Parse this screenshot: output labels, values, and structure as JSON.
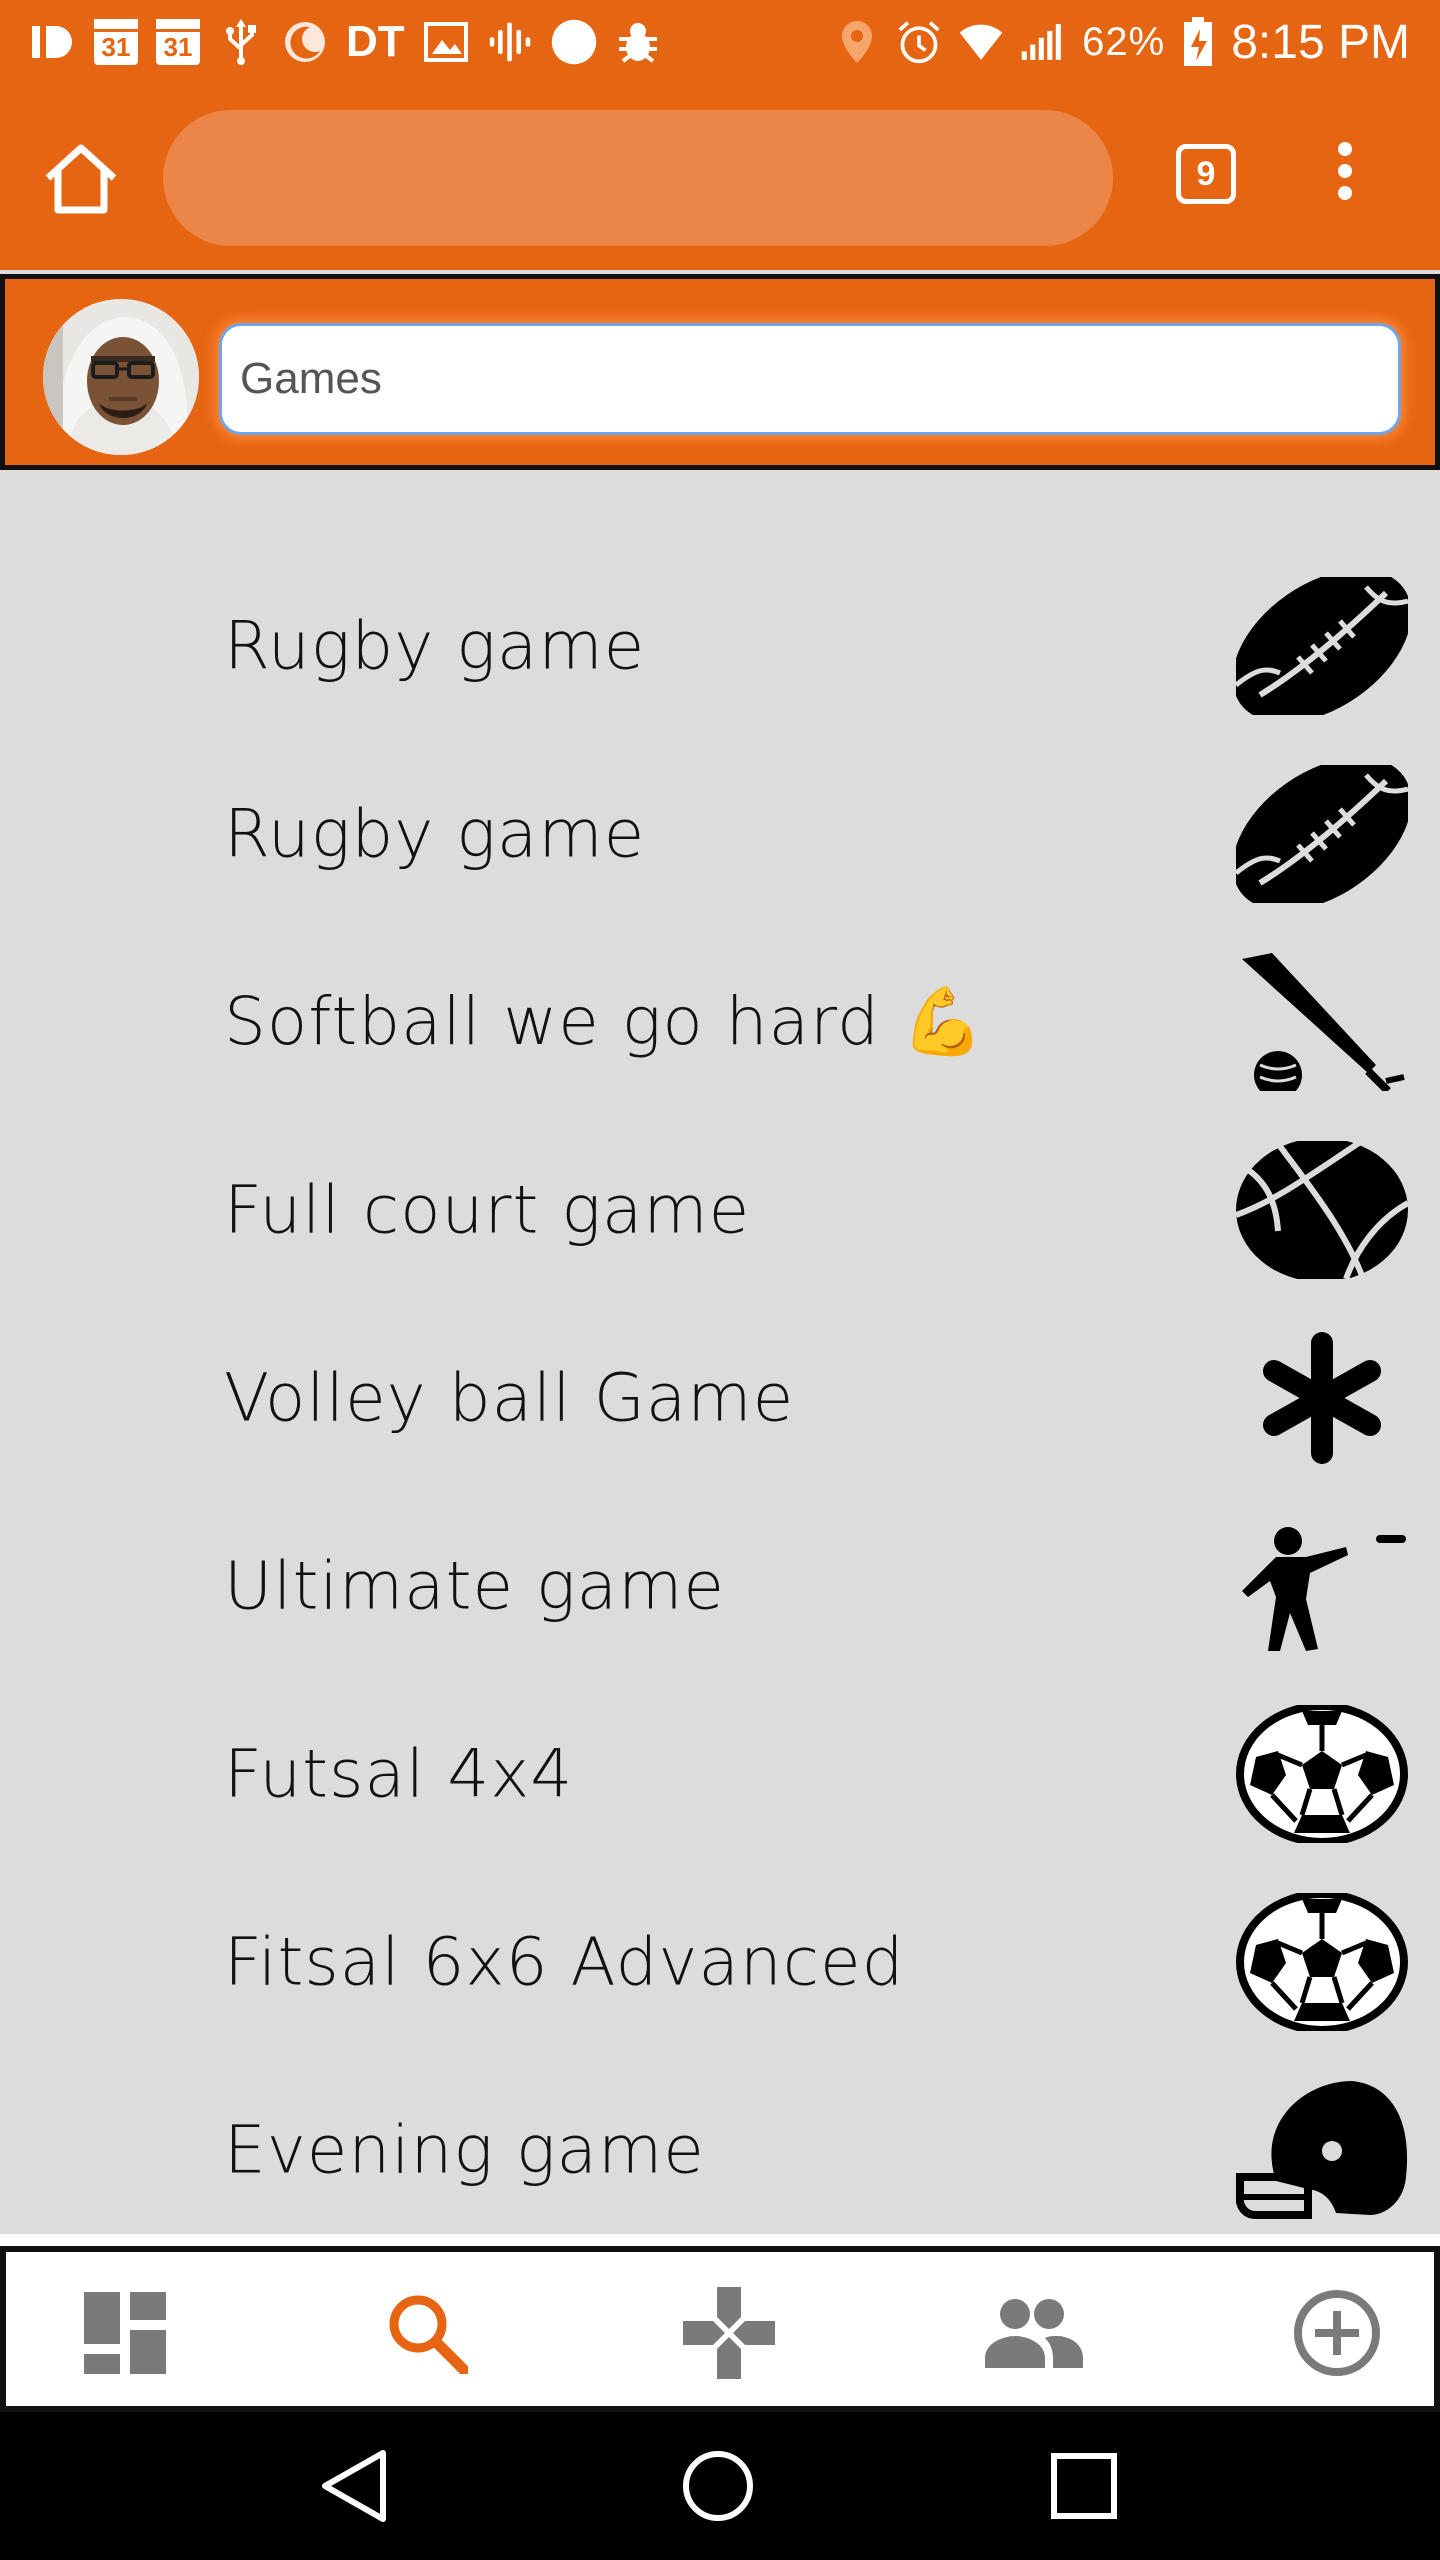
{
  "status_bar": {
    "calendar_day_1": "31",
    "calendar_day_2": "31",
    "dt_label": "DT",
    "battery_percent": "62%",
    "time": "8:15 PM",
    "icons": [
      "id-icon",
      "calendar-icon",
      "calendar-icon",
      "usb-icon",
      "moon-icon",
      "image-icon",
      "podcast-icon",
      "circle-icon",
      "bug-icon",
      "location-icon",
      "alarm-icon",
      "wifi-icon",
      "signal-icon",
      "battery-charging-icon"
    ]
  },
  "browser": {
    "url_value": "",
    "tab_count": "9",
    "icons": [
      "home-icon",
      "more-vert-icon"
    ]
  },
  "header": {
    "search_value": "Games",
    "search_placeholder": ""
  },
  "games": [
    {
      "label": "Rugby game",
      "icon": "rugby-ball-icon"
    },
    {
      "label": "Rugby game",
      "icon": "rugby-ball-icon"
    },
    {
      "label": "Softball we go hard 💪",
      "icon": "softball-bat-icon"
    },
    {
      "label": "Full court game",
      "icon": "basketball-icon"
    },
    {
      "label": "Volley ball Game",
      "icon": "asterisk-icon"
    },
    {
      "label": "Ultimate game",
      "icon": "frisbee-thrower-icon"
    },
    {
      "label": "Futsal 4x4",
      "icon": "soccer-ball-icon"
    },
    {
      "label": "Fitsal 6x6 Advanced",
      "icon": "soccer-ball-icon"
    },
    {
      "label": "Evening game",
      "icon": "football-helmet-icon"
    }
  ],
  "bottom_nav": {
    "items": [
      "dashboard-icon",
      "search-icon",
      "gamepad-icon",
      "people-icon",
      "add-circle-icon"
    ],
    "active": "search-icon",
    "colors": {
      "active": "#e66512",
      "inactive": "#7a7a7a"
    }
  },
  "colors": {
    "brand": "#e66512",
    "list_bg": "#dcdcdc"
  }
}
